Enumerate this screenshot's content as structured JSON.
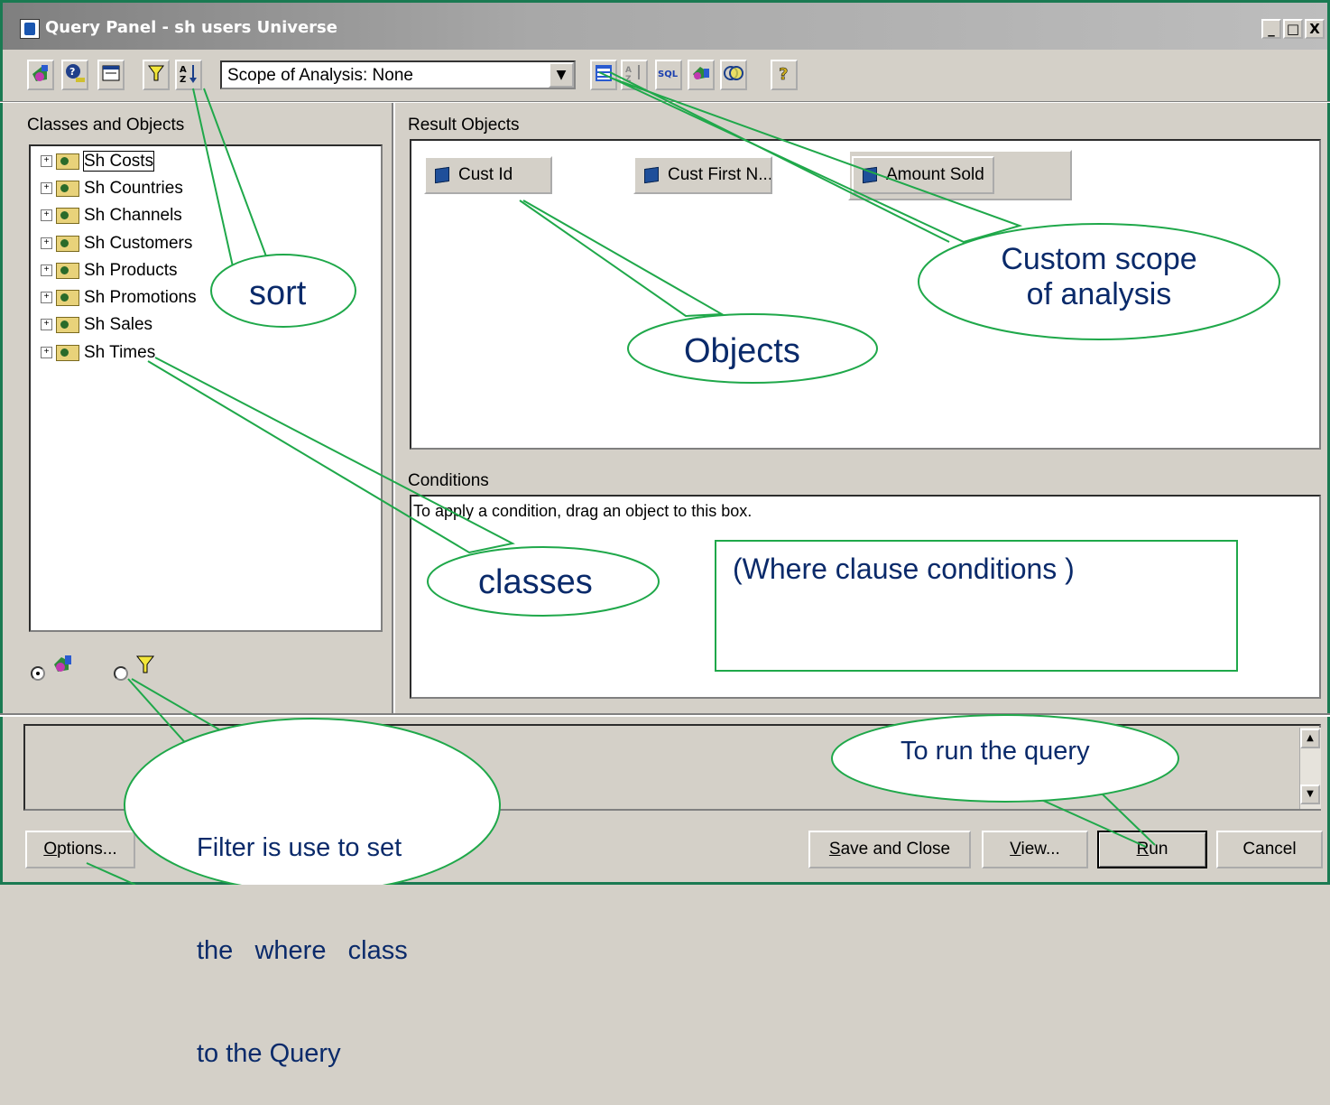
{
  "window": {
    "title": "Query Panel - sh users Universe",
    "controls": [
      "_",
      "□",
      "X"
    ]
  },
  "toolbar": {
    "left_icons": [
      "universe-icon",
      "help-object-icon",
      "panel-layout-icon",
      "filter-icon",
      "sort-icon"
    ],
    "scope_combo_value": "Scope of Analysis: None",
    "right_icons": [
      "scope-hierarchy-icon",
      "sort-list-icon",
      "sql-icon",
      "combine-queries-icon",
      "intersect-icon",
      "help-icon"
    ],
    "sql_label": "SQL"
  },
  "left_panel": {
    "header": "Classes and Objects",
    "tree": [
      {
        "label": "Sh Costs",
        "selected": true
      },
      {
        "label": "Sh Countries",
        "selected": false
      },
      {
        "label": "Sh Channels",
        "selected": false
      },
      {
        "label": "Sh Customers",
        "selected": false
      },
      {
        "label": "Sh Products",
        "selected": false
      },
      {
        "label": "Sh Promotions",
        "selected": false
      },
      {
        "label": "Sh Sales",
        "selected": false
      },
      {
        "label": "Sh Times",
        "selected": false
      }
    ],
    "view_mode": "classes"
  },
  "result": {
    "header": "Result Objects",
    "objects": [
      "Cust Id",
      "Cust First N...",
      "Amount Sold"
    ]
  },
  "conditions": {
    "header": "Conditions",
    "hint": "To apply a condition, drag an object to this box."
  },
  "buttons": {
    "options": "Options...",
    "options_mnemonic": "O",
    "save_close": "Save and Close",
    "save_close_mnemonic": "S",
    "view": "View...",
    "view_mnemonic": "V",
    "run": "Run",
    "run_mnemonic": "R",
    "cancel": "Cancel"
  },
  "annotations": {
    "sort": "sort",
    "classes": "classes",
    "objects": "Objects",
    "custom_scope_line1": "Custom scope",
    "custom_scope_line2": "of analysis",
    "where_clause": "(Where clause conditions )",
    "run_query": "To run the query",
    "filter_line1": "Filter is use to set",
    "filter_line2": "the   where   class",
    "filter_line3": "to the Query"
  },
  "colors": {
    "window_border": "#1a7a52",
    "callout_stroke": "#1fa84a",
    "callout_text": "#0a2a6a",
    "dialog_face": "#d4d0c8"
  }
}
